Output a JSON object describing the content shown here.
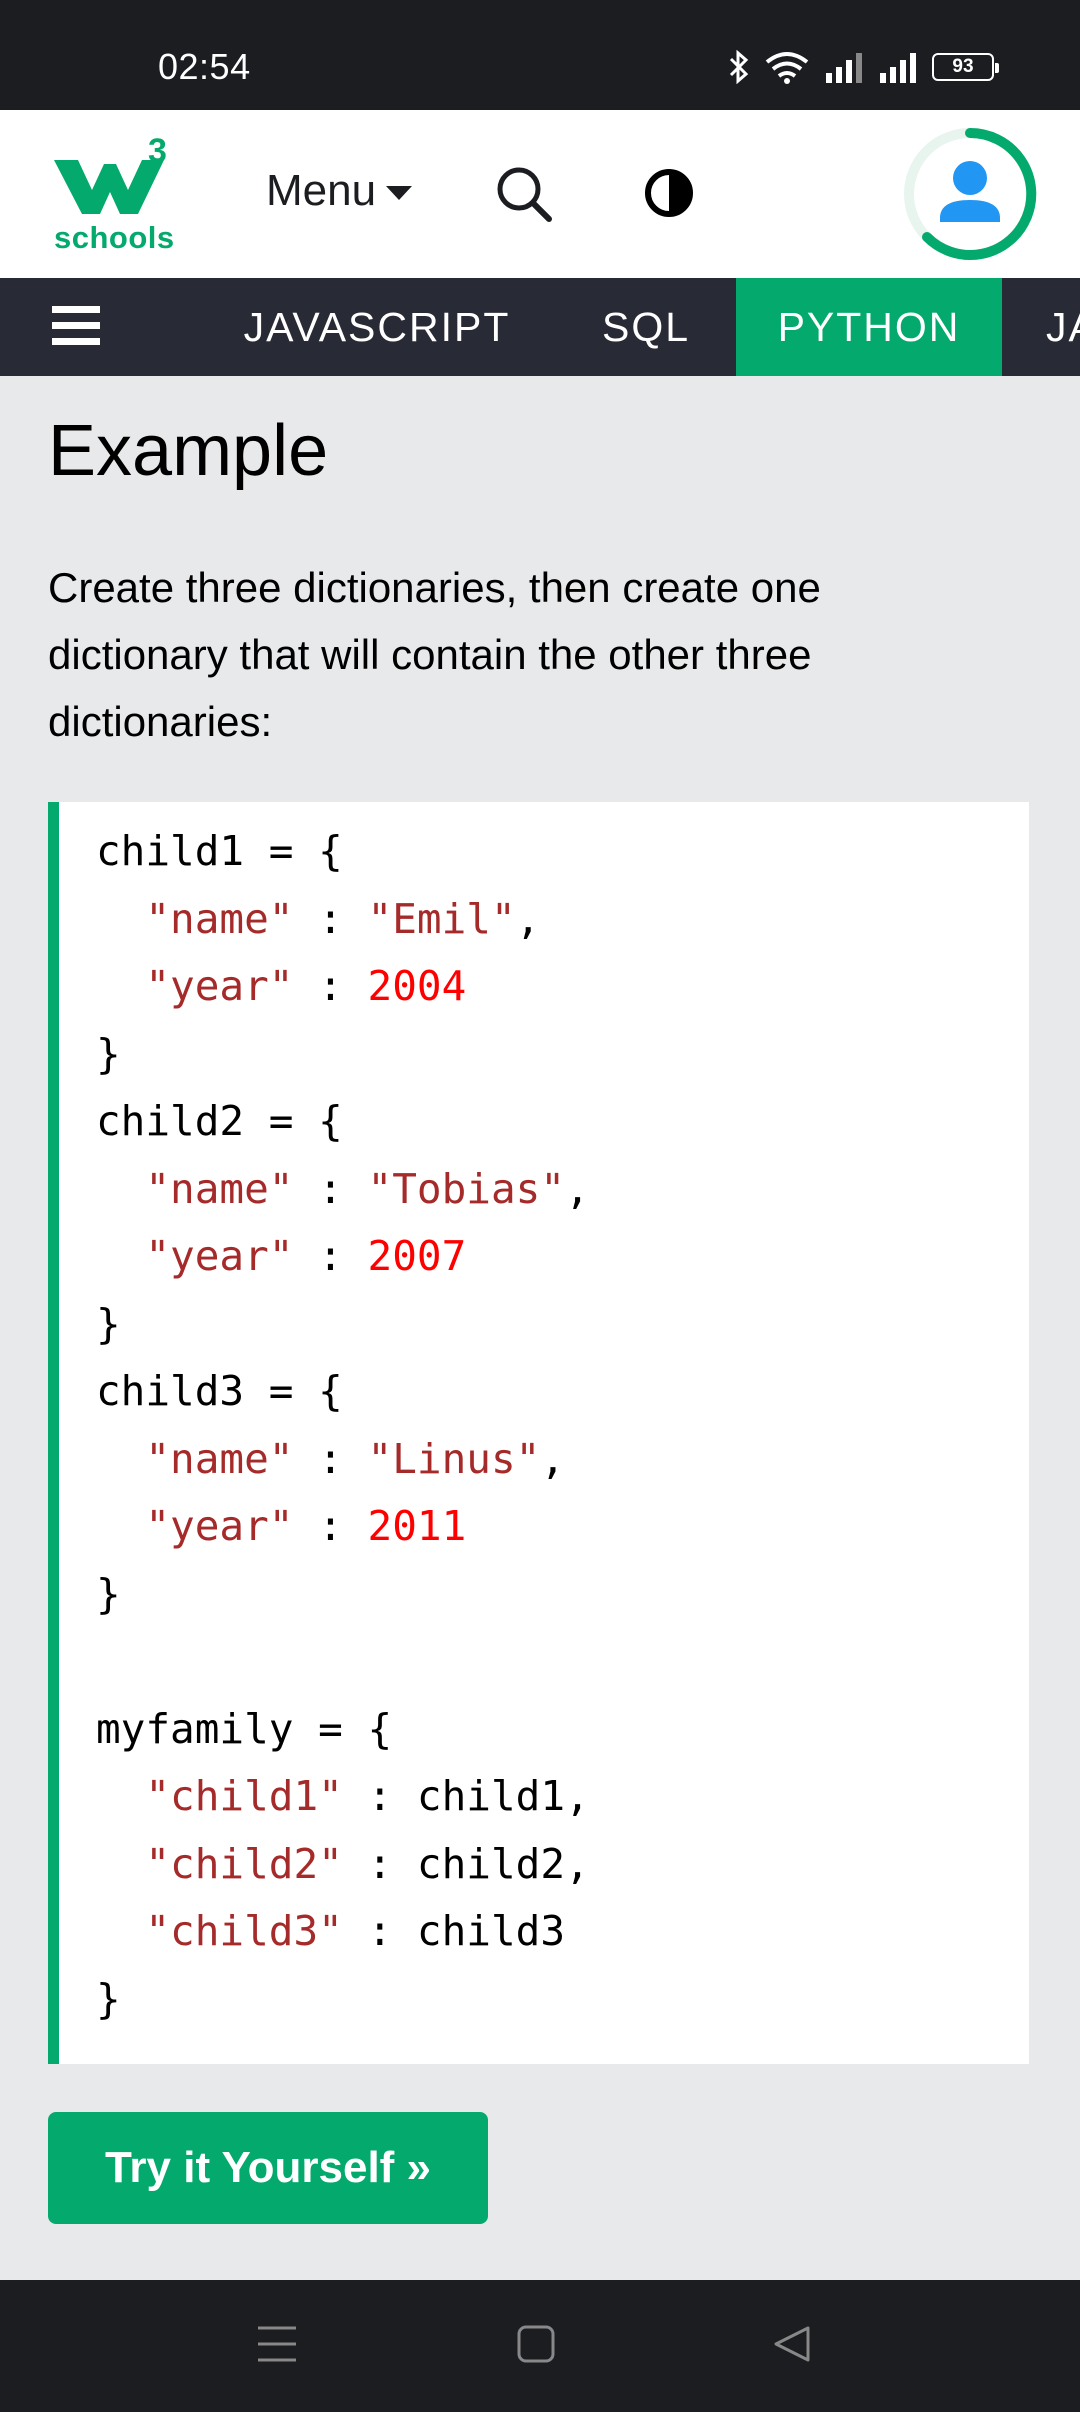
{
  "status_bar": {
    "time": "02:54",
    "battery": "93",
    "icons": [
      "bluetooth-icon",
      "wifi-icon",
      "signal-icon",
      "signal-icon",
      "battery-icon"
    ]
  },
  "header": {
    "logo_superscript": "3",
    "logo_text": "schools",
    "menu_label": "Menu",
    "brand_color": "#04aa6d"
  },
  "subject_tabs": [
    {
      "label": "JAVASCRIPT",
      "active": false
    },
    {
      "label": "SQL",
      "active": false
    },
    {
      "label": "PYTHON",
      "active": true
    },
    {
      "label": "JA",
      "active": false
    }
  ],
  "example": {
    "title": "Example",
    "description": "Create three dictionaries, then create one dictionary that will contain the other three dictionaries:",
    "code_lines": [
      [
        {
          "t": "child1 = {",
          "c": "plain"
        }
      ],
      [
        {
          "t": "  ",
          "c": "plain"
        },
        {
          "t": "\"name\"",
          "c": "str"
        },
        {
          "t": " : ",
          "c": "plain"
        },
        {
          "t": "\"Emil\"",
          "c": "str"
        },
        {
          "t": ",",
          "c": "plain"
        }
      ],
      [
        {
          "t": "  ",
          "c": "plain"
        },
        {
          "t": "\"year\"",
          "c": "str"
        },
        {
          "t": " : ",
          "c": "plain"
        },
        {
          "t": "2004",
          "c": "num"
        }
      ],
      [
        {
          "t": "}",
          "c": "plain"
        }
      ],
      [
        {
          "t": "child2 = {",
          "c": "plain"
        }
      ],
      [
        {
          "t": "  ",
          "c": "plain"
        },
        {
          "t": "\"name\"",
          "c": "str"
        },
        {
          "t": " : ",
          "c": "plain"
        },
        {
          "t": "\"Tobias\"",
          "c": "str"
        },
        {
          "t": ",",
          "c": "plain"
        }
      ],
      [
        {
          "t": "  ",
          "c": "plain"
        },
        {
          "t": "\"year\"",
          "c": "str"
        },
        {
          "t": " : ",
          "c": "plain"
        },
        {
          "t": "2007",
          "c": "num"
        }
      ],
      [
        {
          "t": "}",
          "c": "plain"
        }
      ],
      [
        {
          "t": "child3 = {",
          "c": "plain"
        }
      ],
      [
        {
          "t": "  ",
          "c": "plain"
        },
        {
          "t": "\"name\"",
          "c": "str"
        },
        {
          "t": " : ",
          "c": "plain"
        },
        {
          "t": "\"Linus\"",
          "c": "str"
        },
        {
          "t": ",",
          "c": "plain"
        }
      ],
      [
        {
          "t": "  ",
          "c": "plain"
        },
        {
          "t": "\"year\"",
          "c": "str"
        },
        {
          "t": " : ",
          "c": "plain"
        },
        {
          "t": "2011",
          "c": "num"
        }
      ],
      [
        {
          "t": "}",
          "c": "plain"
        }
      ],
      [],
      [
        {
          "t": "myfamily = {",
          "c": "plain"
        }
      ],
      [
        {
          "t": "  ",
          "c": "plain"
        },
        {
          "t": "\"child1\"",
          "c": "str"
        },
        {
          "t": " : child1,",
          "c": "plain"
        }
      ],
      [
        {
          "t": "  ",
          "c": "plain"
        },
        {
          "t": "\"child2\"",
          "c": "str"
        },
        {
          "t": " : child2,",
          "c": "plain"
        }
      ],
      [
        {
          "t": "  ",
          "c": "plain"
        },
        {
          "t": "\"child3\"",
          "c": "str"
        },
        {
          "t": " : child3",
          "c": "plain"
        }
      ],
      [
        {
          "t": "}",
          "c": "plain"
        }
      ]
    ],
    "try_button_label": "Try it Yourself »"
  },
  "nav_bar": {
    "buttons": [
      "recent-apps-icon",
      "home-icon",
      "back-icon"
    ]
  }
}
